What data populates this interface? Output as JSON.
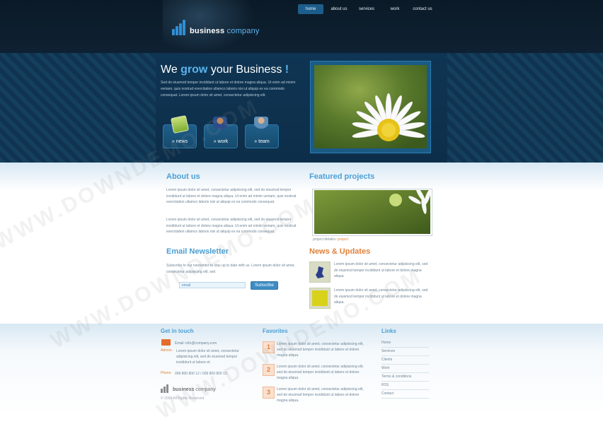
{
  "nav": {
    "items": [
      {
        "label": "home",
        "active": true
      },
      {
        "label": "about us",
        "active": false
      },
      {
        "label": "services",
        "active": false
      },
      {
        "label": "work",
        "active": false
      },
      {
        "label": "contact us",
        "active": false
      }
    ]
  },
  "brand": {
    "name_bold": "business",
    "name_light": " company",
    "accent_color": "#59b4ee"
  },
  "hero": {
    "title_before": "We ",
    "title_highlight": "grow",
    "title_after": " your Business ",
    "title_bang": "!",
    "text": "Sed do eiusmod tempor incididunt ut labore et dolore magna aliqua. Ut enim ad minim veniam, quis nostrud exercitation ullamco laboris nisi ut aliquip ex ea commodo consequat. Lorem ipsum dolor sit amet, consectetur adipisicing elit."
  },
  "quick_links": [
    {
      "label": "» news",
      "icon": "notepad-icon"
    },
    {
      "label": "» work",
      "icon": "worker-icon"
    },
    {
      "label": "» team",
      "icon": "person-icon"
    }
  ],
  "about": {
    "title": "About us",
    "p1": "Lorem ipsum dolor sit amet, consectetur adipisicing elit, sed do eiusmod tempor incididunt ut labore et dolore magna aliqua. Ut enim ad minim veniam, quis nostrud exercitation ullamco laboris nisi ut aliquip ex ea commodo consequat.",
    "p2": "Lorem ipsum dolor sit amet, consectetur adipisicing elit, sed do eiusmod tempor incididunt ut labore et dolore magna aliqua. Ut enim ad minim veniam, quis nostrud exercitation ullamco laboris nisi ut aliquip ex ea commodo consequat."
  },
  "featured": {
    "title": "Featured projects",
    "caption_label": "project details",
    "caption_link": "» project"
  },
  "newsletter": {
    "title": "Email Newsletter",
    "text": "Subscribe to our newsletter to stay up to date with us. Lorem ipsum dolor sit amet, consectetur adipisicing elit, sed",
    "input_value": "email",
    "button_label": "Subscribe"
  },
  "news": {
    "title": "News & Updates",
    "items": [
      {
        "text": "Lorem ipsum dolor sit amet, consectetur adipisicing elit, sed do eiusmod tempor incididunt ut labore et dolore magna aliqua."
      },
      {
        "text": "Lorem ipsum dolor sit amet, consectetur adipisicing elit, sed do eiusmod tempor incididunt ut labore et dolore magna aliqua."
      }
    ]
  },
  "footer": {
    "contact": {
      "title": "Get in touch",
      "email": "Email: info@company.com",
      "address_label": "Adress:",
      "address": "Lorem ipsum dolor sit amet, consectetur adipisicing elit, sed do eiusmod tempor incididunt ut labore et.",
      "phone_label": "Phone:",
      "phone": "009 800 800 12 / 009 800 800 13"
    },
    "favorites": {
      "title": "Favorites",
      "items": [
        {
          "num": "1",
          "text": "Lorem ipsum dolor sit amet, consectetur adipisicing elit, sed do eiusmod tempor incididunt ut labore et dolore magna aliqua."
        },
        {
          "num": "2",
          "text": "Lorem ipsum dolor sit amet, consectetur adipisicing elit, sed do eiusmod tempor incididunt ut labore et dolore magna aliqua."
        },
        {
          "num": "3",
          "text": "Lorem ipsum dolor sit amet, consectetur adipisicing elit, sed do eiusmod tempor incididunt ut labore et dolore magna aliqua."
        }
      ]
    },
    "links": {
      "title": "Links",
      "items": [
        "Home",
        "Services",
        "Clients",
        "Work",
        "Terms & conditions",
        "RSS",
        "Contact"
      ]
    },
    "logo_bold": "business",
    "logo_light": " company",
    "copyright": "© 2009 All Rights Reserved"
  },
  "watermark": "WWW.DOWNDEMO.COM"
}
